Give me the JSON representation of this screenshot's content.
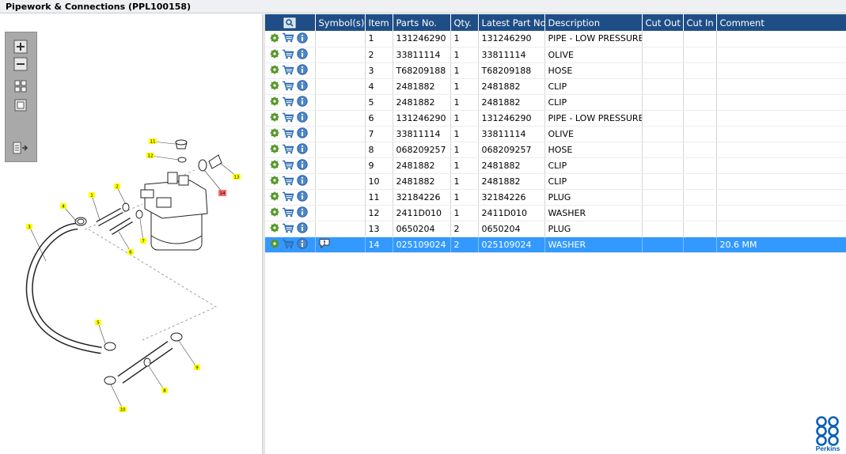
{
  "window": {
    "title": "Pipework & Connections (PPL100158)"
  },
  "grid": {
    "columns": [
      "",
      "Symbol(s)",
      "Item",
      "Parts No.",
      "Qty.",
      "Latest Part No.",
      "Description",
      "Cut Out",
      "Cut In",
      "Comment"
    ],
    "rows": [
      {
        "item": "1",
        "part": "131246290",
        "qty": "1",
        "latest": "131246290",
        "desc": "PIPE - LOW PRESSURE F",
        "cut_out": "",
        "cut_in": "",
        "comment": ""
      },
      {
        "item": "2",
        "part": "33811114",
        "qty": "1",
        "latest": "33811114",
        "desc": "OLIVE",
        "cut_out": "",
        "cut_in": "",
        "comment": ""
      },
      {
        "item": "3",
        "part": "T68209188",
        "qty": "1",
        "latest": "T68209188",
        "desc": "HOSE",
        "cut_out": "",
        "cut_in": "",
        "comment": ""
      },
      {
        "item": "4",
        "part": "2481882",
        "qty": "1",
        "latest": "2481882",
        "desc": "CLIP",
        "cut_out": "",
        "cut_in": "",
        "comment": ""
      },
      {
        "item": "5",
        "part": "2481882",
        "qty": "1",
        "latest": "2481882",
        "desc": "CLIP",
        "cut_out": "",
        "cut_in": "",
        "comment": ""
      },
      {
        "item": "6",
        "part": "131246290",
        "qty": "1",
        "latest": "131246290",
        "desc": "PIPE - LOW PRESSURE F",
        "cut_out": "",
        "cut_in": "",
        "comment": ""
      },
      {
        "item": "7",
        "part": "33811114",
        "qty": "1",
        "latest": "33811114",
        "desc": "OLIVE",
        "cut_out": "",
        "cut_in": "",
        "comment": ""
      },
      {
        "item": "8",
        "part": "068209257",
        "qty": "1",
        "latest": "068209257",
        "desc": "HOSE",
        "cut_out": "",
        "cut_in": "",
        "comment": ""
      },
      {
        "item": "9",
        "part": "2481882",
        "qty": "1",
        "latest": "2481882",
        "desc": "CLIP",
        "cut_out": "",
        "cut_in": "",
        "comment": ""
      },
      {
        "item": "10",
        "part": "2481882",
        "qty": "1",
        "latest": "2481882",
        "desc": "CLIP",
        "cut_out": "",
        "cut_in": "",
        "comment": ""
      },
      {
        "item": "11",
        "part": "32184226",
        "qty": "1",
        "latest": "32184226",
        "desc": "PLUG",
        "cut_out": "",
        "cut_in": "",
        "comment": ""
      },
      {
        "item": "12",
        "part": "2411D010",
        "qty": "1",
        "latest": "2411D010",
        "desc": "WASHER",
        "cut_out": "",
        "cut_in": "",
        "comment": ""
      },
      {
        "item": "13",
        "part": "0650204",
        "qty": "2",
        "latest": "0650204",
        "desc": "PLUG",
        "cut_out": "",
        "cut_in": "",
        "comment": ""
      },
      {
        "item": "14",
        "part": "025109024",
        "qty": "2",
        "latest": "025109024",
        "desc": "WASHER",
        "cut_out": "",
        "cut_in": "",
        "comment": "20.6 MM",
        "selected": true
      }
    ]
  },
  "diagram": {
    "callouts": [
      "1",
      "2",
      "3",
      "4",
      "5",
      "6",
      "7",
      "8",
      "9",
      "10",
      "11",
      "12",
      "13",
      "14"
    ],
    "highlighted_callout": "14"
  },
  "icons": {
    "row_actions": [
      "gear-icon",
      "cart-icon",
      "info-icon"
    ],
    "symbol_row_14": "exclamation-bubble-icon",
    "toolbar": [
      "zoom-in-icon",
      "zoom-out-icon",
      "fit-page-icon",
      "actual-size-icon",
      "toggle-list-icon"
    ]
  },
  "colors": {
    "header_bg": "#1f4e86",
    "selected_row": "#3399ff",
    "callout_yellow": "#ffff00",
    "callout_highlight": "#ff6b6b",
    "brand_blue": "#0a5fb4"
  },
  "brand": {
    "logo_text": "Perkins"
  }
}
